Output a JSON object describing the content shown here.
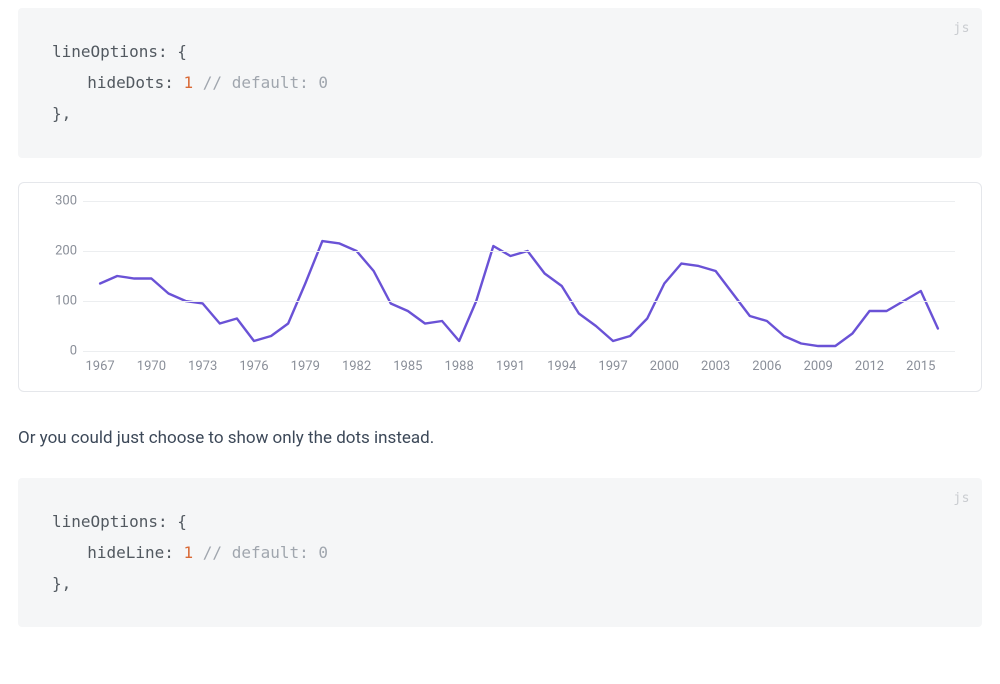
{
  "code1": {
    "lang": "js",
    "l1a": "lineOptions",
    "l1b": ": {",
    "l2a": "hideDots",
    "l2b": ": ",
    "l2num": "1",
    "l2c": " ",
    "l2comment": "// default: 0",
    "l3": "},"
  },
  "prose1": "Or you could just choose to show only the dots instead.",
  "code2": {
    "lang": "js",
    "l1a": "lineOptions",
    "l1b": ": {",
    "l2a": "hideLine",
    "l2b": ": ",
    "l2num": "1",
    "l2c": " ",
    "l2comment": "// default: 0",
    "l3": "},"
  },
  "chart_data": {
    "type": "line",
    "title": "",
    "xlabel": "",
    "ylabel": "",
    "ylim": [
      0,
      300
    ],
    "y_ticks": [
      0,
      100,
      200,
      300
    ],
    "x_tick_labels": [
      "1967",
      "1970",
      "1973",
      "1976",
      "1979",
      "1982",
      "1985",
      "1988",
      "1991",
      "1994",
      "1997",
      "2000",
      "2003",
      "2006",
      "2009",
      "2012",
      "2015"
    ],
    "x_tick_values": [
      1967,
      1970,
      1973,
      1976,
      1979,
      1982,
      1985,
      1988,
      1991,
      1994,
      1997,
      2000,
      2003,
      2006,
      2009,
      2012,
      2015
    ],
    "xlim": [
      1966,
      2017
    ],
    "line_color": "#6a52d6",
    "x": [
      1967,
      1968,
      1969,
      1970,
      1971,
      1972,
      1973,
      1974,
      1975,
      1976,
      1977,
      1978,
      1979,
      1980,
      1981,
      1982,
      1983,
      1984,
      1985,
      1986,
      1987,
      1988,
      1989,
      1990,
      1991,
      1992,
      1993,
      1994,
      1995,
      1996,
      1997,
      1998,
      1999,
      2000,
      2001,
      2002,
      2003,
      2004,
      2005,
      2006,
      2007,
      2008,
      2009,
      2010,
      2011,
      2012,
      2013,
      2014,
      2015,
      2016
    ],
    "values": [
      135,
      150,
      145,
      145,
      115,
      100,
      95,
      55,
      65,
      20,
      30,
      55,
      135,
      220,
      215,
      200,
      160,
      95,
      80,
      55,
      60,
      20,
      100,
      210,
      190,
      200,
      155,
      130,
      75,
      50,
      20,
      30,
      65,
      135,
      175,
      170,
      160,
      115,
      70,
      60,
      30,
      15,
      10,
      10,
      35,
      80,
      80,
      100,
      120,
      45
    ]
  }
}
